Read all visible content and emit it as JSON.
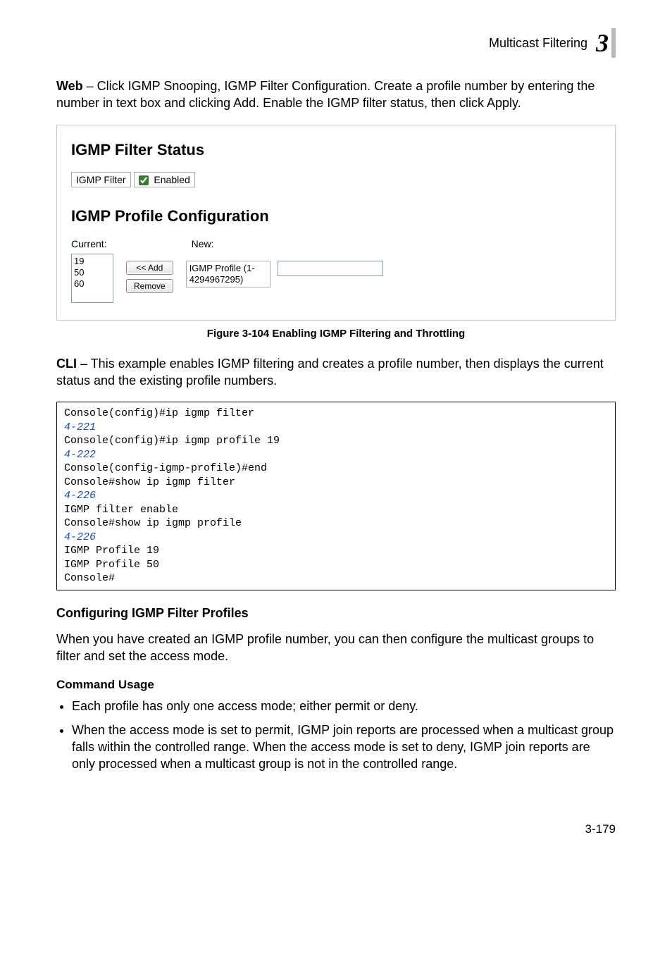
{
  "header": {
    "section": "Multicast Filtering",
    "chapter": "3"
  },
  "intro": {
    "bold": "Web",
    "text": " – Click IGMP Snooping, IGMP Filter Configuration. Create a profile number by entering the number in text box and clicking Add. Enable the IGMP filter status, then click Apply."
  },
  "panel": {
    "h_status": "IGMP Filter Status",
    "filter_label": "IGMP Filter",
    "filter_enabled_label": "Enabled",
    "filter_checked": true,
    "h_profile": "IGMP Profile Configuration",
    "current_label": "Current:",
    "new_label": "New:",
    "list_items": [
      "19",
      "50",
      "60"
    ],
    "btn_add": "<< Add",
    "btn_remove": "Remove",
    "new_field_label_line1": "IGMP Profile (1-",
    "new_field_label_line2": "4294967295)",
    "new_value": ""
  },
  "figure_caption": "Figure 3-104  Enabling IGMP Filtering and Throttling",
  "cli": {
    "bold": "CLI",
    "text": " – This example enables IGMP filtering and creates a profile number, then displays the current status and the existing profile numbers."
  },
  "code": {
    "l1": "Console(config)#ip igmp filter",
    "l2": "4-221",
    "l3": "Console(config)#ip igmp profile 19",
    "l4": "4-222",
    "l5": "Console(config-igmp-profile)#end",
    "l6": "Console#show ip igmp filter",
    "l7": "4-226",
    "l8": "IGMP filter enable",
    "l9": "Console#show ip igmp profile",
    "l10": "4-226",
    "l11": "IGMP Profile 19",
    "l12": "IGMP Profile 50",
    "l13": "Console#"
  },
  "section_h3": "Configuring IGMP Filter Profiles",
  "section_p": "When you have created an IGMP profile number, you can then configure the multicast groups to filter and set the access mode.",
  "cmd_usage_h": "Command Usage",
  "bullets": [
    "Each profile has only one access mode; either permit or deny.",
    "When the access mode is set to permit, IGMP join reports are processed when a multicast group falls within the controlled range. When the access mode is set to deny, IGMP join reports are only processed when a multicast group is not in the controlled range."
  ],
  "page_number": "3-179"
}
